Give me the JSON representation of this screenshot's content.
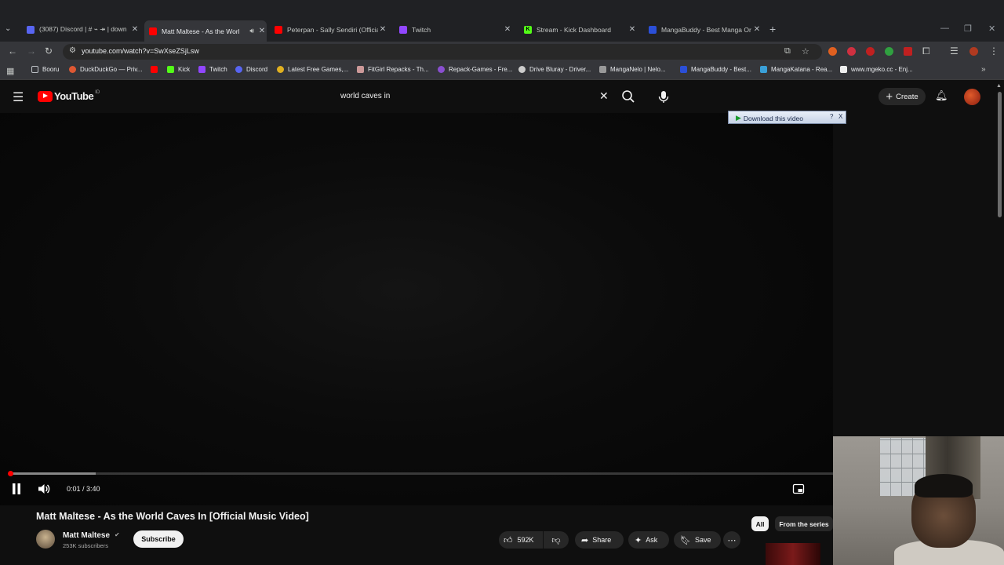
{
  "browser": {
    "tabs": [
      {
        "title": "(3087) Discord | # ⌁ ↠ | down",
        "favicon_color": "#5865f2",
        "audio": false,
        "active": false
      },
      {
        "title": "Matt Maltese - As the Worl",
        "favicon_color": "#ff0000",
        "audio": true,
        "active": true
      },
      {
        "title": "Peterpan - Sally Sendiri (Officia",
        "favicon_color": "#ff0000",
        "audio": false,
        "active": false
      },
      {
        "title": "Twitch",
        "favicon_color": "#9146ff",
        "audio": false,
        "active": false
      },
      {
        "title": "Stream - Kick Dashboard",
        "favicon_color": "#53fc18",
        "audio": false,
        "active": false
      },
      {
        "title": "MangaBuddy - Best Manga Or",
        "favicon_color": "#2b4fd8",
        "audio": false,
        "active": false
      }
    ],
    "url": "youtube.com/watch?v=SwXseZSjLsw",
    "bookmarks": [
      {
        "label": "Booru",
        "icon": "folder-icon",
        "color": "#bdc1c6"
      },
      {
        "label": "DuckDuckGo — Priv...",
        "icon": "duckduckgo-icon",
        "color": "#de5833"
      },
      {
        "label": "",
        "icon": "youtube-icon",
        "color": "#ff0000"
      },
      {
        "label": "Kick",
        "icon": "kick-icon",
        "color": "#53fc18"
      },
      {
        "label": "Twitch",
        "icon": "twitch-icon",
        "color": "#9146ff"
      },
      {
        "label": "Discord",
        "icon": "discord-icon",
        "color": "#5865f2"
      },
      {
        "label": "Latest Free Games,...",
        "icon": "games-icon",
        "color": "#e0b020"
      },
      {
        "label": "FitGirl Repacks - Th...",
        "icon": "fitgirl-icon",
        "color": "#c99"
      },
      {
        "label": "Repack-Games - Fre...",
        "icon": "repack-icon",
        "color": "#8a4fd0"
      },
      {
        "label": "Drive Bluray - Driver...",
        "icon": "drive-icon",
        "color": "#ccc"
      },
      {
        "label": "MangaNelo | Nelo...",
        "icon": "manganelo-icon",
        "color": "#999"
      },
      {
        "label": "MangaBuddy - Best...",
        "icon": "mangabuddy-icon",
        "color": "#2b4fd8"
      },
      {
        "label": "MangaKatana - Rea...",
        "icon": "mangakatana-icon",
        "color": "#3aa0d8"
      },
      {
        "label": "www.mgeko.cc - Enj...",
        "icon": "mgeko-icon",
        "color": "#eee"
      }
    ]
  },
  "youtube": {
    "logo_text": "YouTube",
    "logo_region": "ID",
    "search_value": "world caves in",
    "create_label": "Create",
    "download_label": "Download this video",
    "download_help": "?",
    "download_close": "X"
  },
  "player": {
    "time_current": "0:01",
    "time_separator": " / ",
    "time_total": "3:40",
    "played_fraction": 0.005,
    "buffered_fraction": 0.105
  },
  "video": {
    "title": "Matt Maltese - As the World Caves In [Official Music Video]",
    "channel": "Matt Maltese",
    "subscribers": "253K subscribers",
    "subscribe_label": "Subscribe",
    "likes": "592K",
    "share_label": "Share",
    "ask_label": "Ask",
    "save_label": "Save"
  },
  "chips": [
    "All",
    "From the series"
  ]
}
